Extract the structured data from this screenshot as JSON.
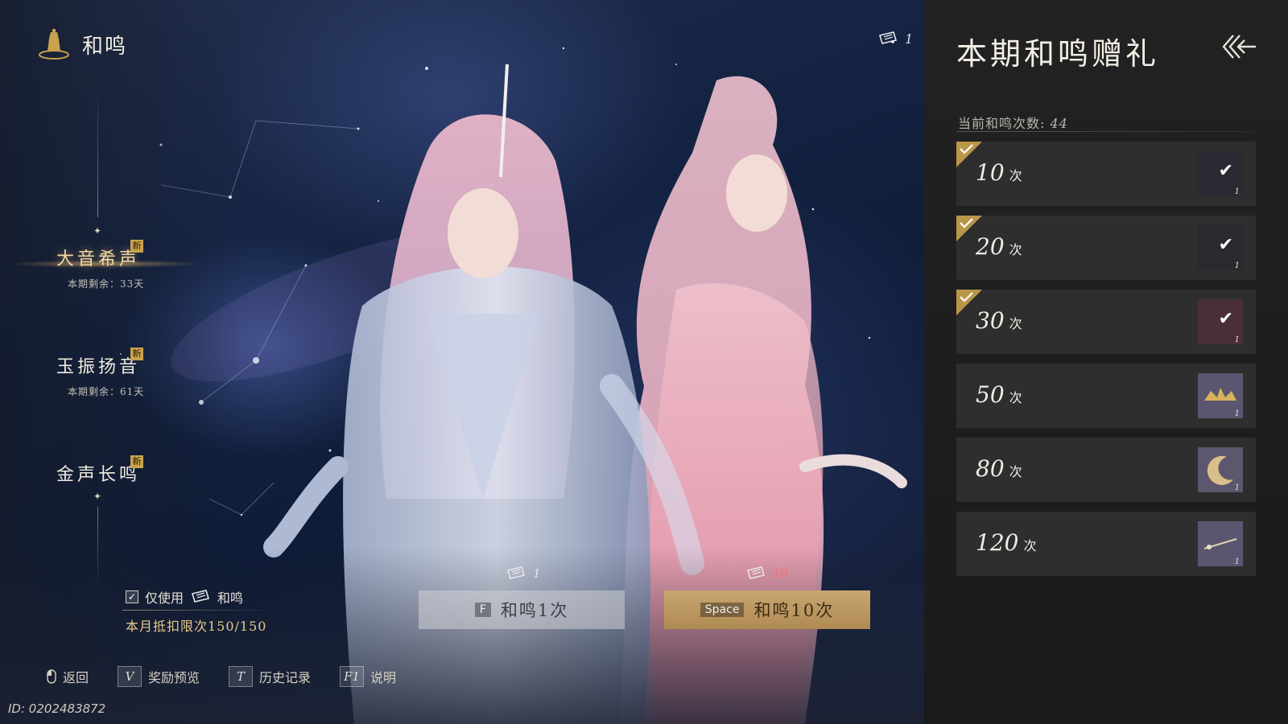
{
  "header": {
    "title": "和鸣",
    "ticket_count": "1"
  },
  "nav": [
    {
      "name": "大音希声",
      "badge": "新",
      "remaining": "本期剩余：33天",
      "active": true
    },
    {
      "name": "玉振扬音",
      "badge": "新",
      "remaining": "本期剩余：61天",
      "active": false
    },
    {
      "name": "金声长鸣",
      "badge": "新",
      "remaining": "",
      "active": false
    }
  ],
  "options": {
    "only_use_prefix": "仅使用",
    "only_use_suffix": "和鸣",
    "only_use_checked": true,
    "monthly_limit": "本月抵扣限次150/150"
  },
  "pull": {
    "one": {
      "cost": "1",
      "key": "F",
      "label": "和鸣1次"
    },
    "ten": {
      "cost": "10",
      "key": "Space",
      "label": "和鸣10次"
    }
  },
  "shortcuts": [
    {
      "key": "",
      "label": "返回",
      "icon": "mouse-icon"
    },
    {
      "key": "V",
      "label": "奖励预览"
    },
    {
      "key": "T",
      "label": "历史记录"
    },
    {
      "key": "F1",
      "label": "说明"
    }
  ],
  "id_text": "ID: 0202483872",
  "panel": {
    "title": "本期和鸣赠礼",
    "count_label": "当前和鸣次数:",
    "count_value": "44",
    "gifts": [
      {
        "count": "10",
        "unit": "次",
        "claimed": true,
        "qty": "1",
        "color": "#2a2a32"
      },
      {
        "count": "20",
        "unit": "次",
        "claimed": true,
        "qty": "1",
        "color": "#2a2a2e"
      },
      {
        "count": "30",
        "unit": "次",
        "claimed": true,
        "qty": "1",
        "color": "#4a3036"
      },
      {
        "count": "50",
        "unit": "次",
        "claimed": false,
        "qty": "1",
        "color": "#5a5670"
      },
      {
        "count": "80",
        "unit": "次",
        "claimed": false,
        "qty": "1",
        "color": "#5c566e"
      },
      {
        "count": "120",
        "unit": "次",
        "claimed": false,
        "qty": "1",
        "color": "#5a5670"
      }
    ]
  },
  "colors": {
    "accent_gold": "#c9a24e",
    "panel_bg": "#222222",
    "ten_button": "#c8a670"
  }
}
